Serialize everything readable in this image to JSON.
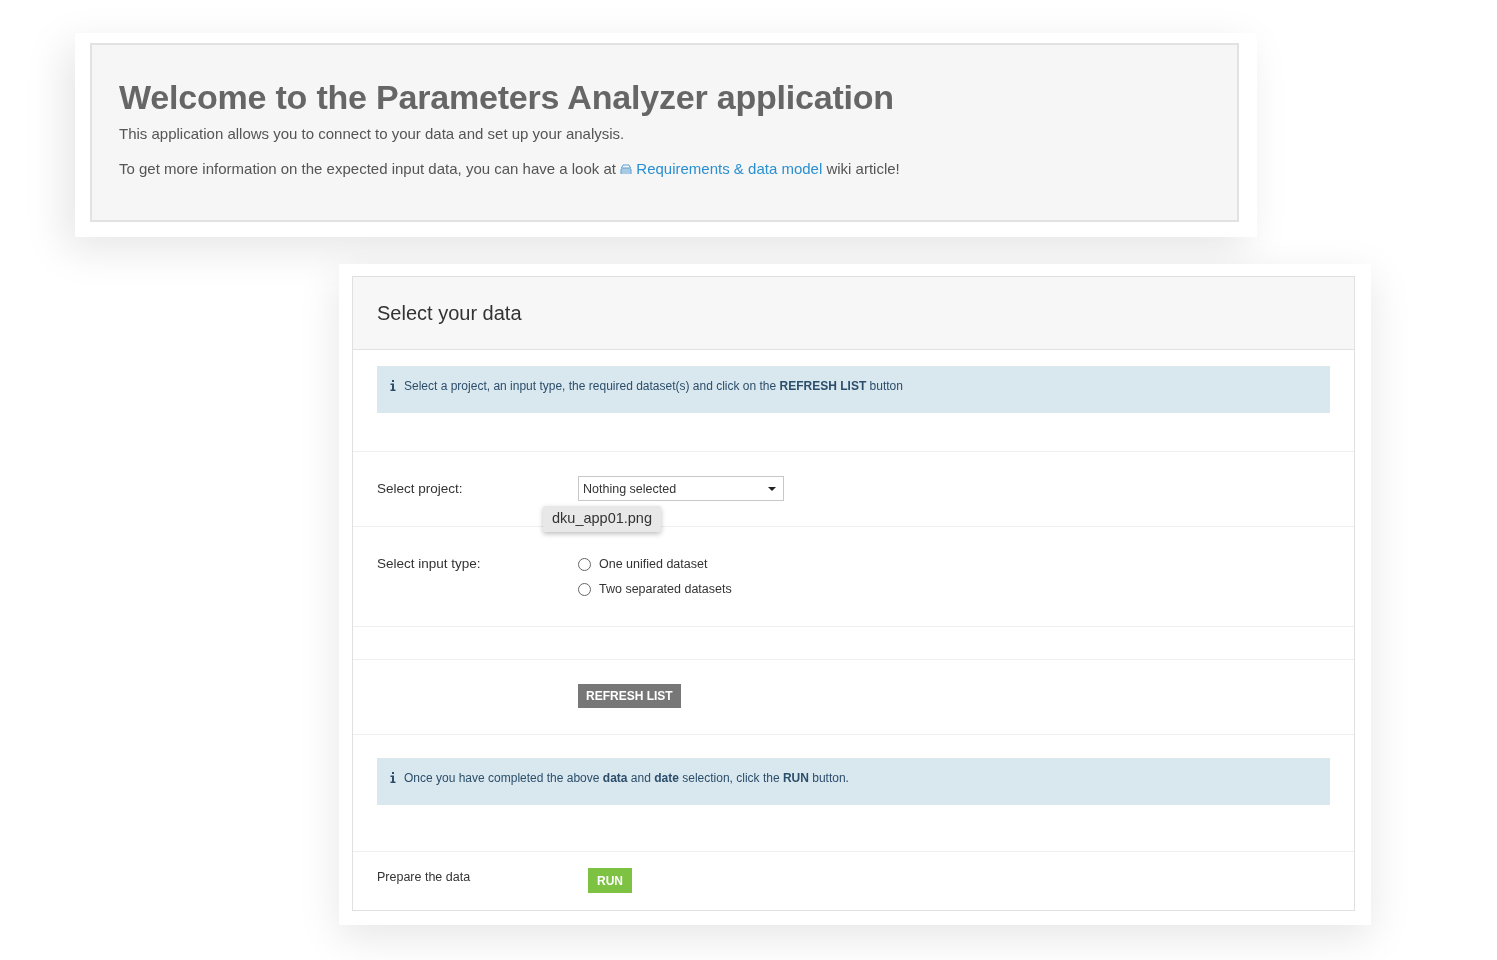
{
  "welcome": {
    "title": "Welcome to the Parameters Analyzer application",
    "intro": "This application allows you to connect to your data and set up your analysis.",
    "more_info": {
      "text_before": "To get more information on the expected input data, you can have a look at",
      "link": "Requirements & data model",
      "text_after": "wiki article!"
    }
  },
  "panel": {
    "title": "Select your data",
    "info": "Select a project, an input type, the required dataset(s) and click on the **REFRESH LIST** button",
    "project": {
      "label": "Select project:",
      "placeholder": "Nothing selected"
    },
    "input_type": {
      "label": "Select input type:",
      "options": [
        {
          "label": "One unified dataset",
          "selected": false
        },
        {
          "label": "Two separated datasets",
          "selected": false
        }
      ]
    },
    "refresh_button": "REFRESH LIST",
    "run_info": "Once you have completed the above **data** and **date** selection, click the **RUN** button.",
    "prepare": {
      "label": "Prepare the data",
      "button": "RUN"
    }
  },
  "tooltip": {
    "text": "dku_app01.png"
  }
}
